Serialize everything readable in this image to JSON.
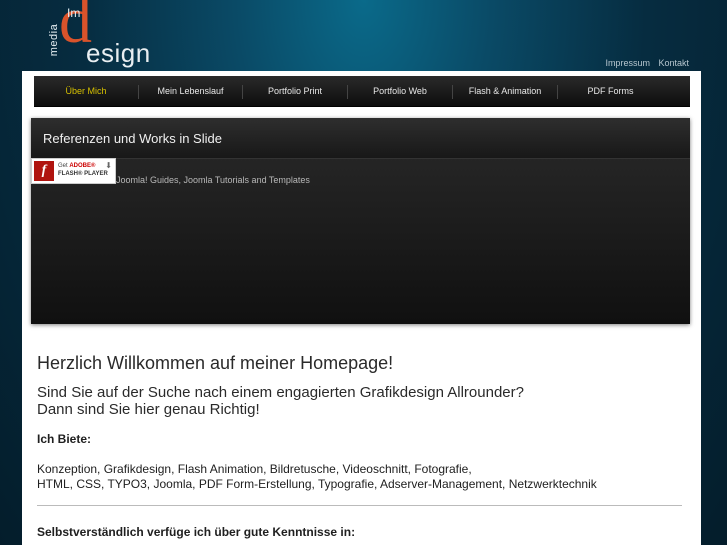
{
  "logo": {
    "im": "Im",
    "media": "media",
    "d": "d",
    "esign": "esign"
  },
  "toplinks": [
    "Impressum",
    "Kontakt"
  ],
  "nav": [
    {
      "label": "Über Mich",
      "active": true
    },
    {
      "label": "Mein Lebenslauf"
    },
    {
      "label": "Portfolio Print"
    },
    {
      "label": "Portfolio Web"
    },
    {
      "label": "Flash & Animation"
    },
    {
      "label": "PDF Forms"
    }
  ],
  "slider": {
    "title": "Referenzen und Works in Slide",
    "caption": "Joomla! Guides, Joomla Tutorials and Templates",
    "flash": {
      "line1_prefix": "Get ",
      "line1_brand": "ADOBE®",
      "line2": "FLASH® PLAYER"
    }
  },
  "content": {
    "welcome": "Herzlich Willkommen auf meiner Homepage!",
    "intro_line1": "Sind Sie auf der Suche nach einem engagierten Grafikdesign Allrounder?",
    "intro_line2": "Dann sind Sie hier genau Richtig!",
    "offer_heading": "Ich Biete:",
    "offer_line1": "Konzeption, Grafikdesign, Flash Animation, Bildretusche, Videoschnitt, Fotografie,",
    "offer_line2": "HTML, CSS, TYPO3, Joomla, PDF Form-Erstellung, Typografie, Adserver-Management, Netzwerktechnik",
    "knowledge_heading": "Selbstverständlich verfüge ich über gute Kenntnisse in:"
  },
  "colors": {
    "accent": "#d9532b",
    "nav_active": "#d6c000",
    "bg_dark": "#062c40"
  }
}
